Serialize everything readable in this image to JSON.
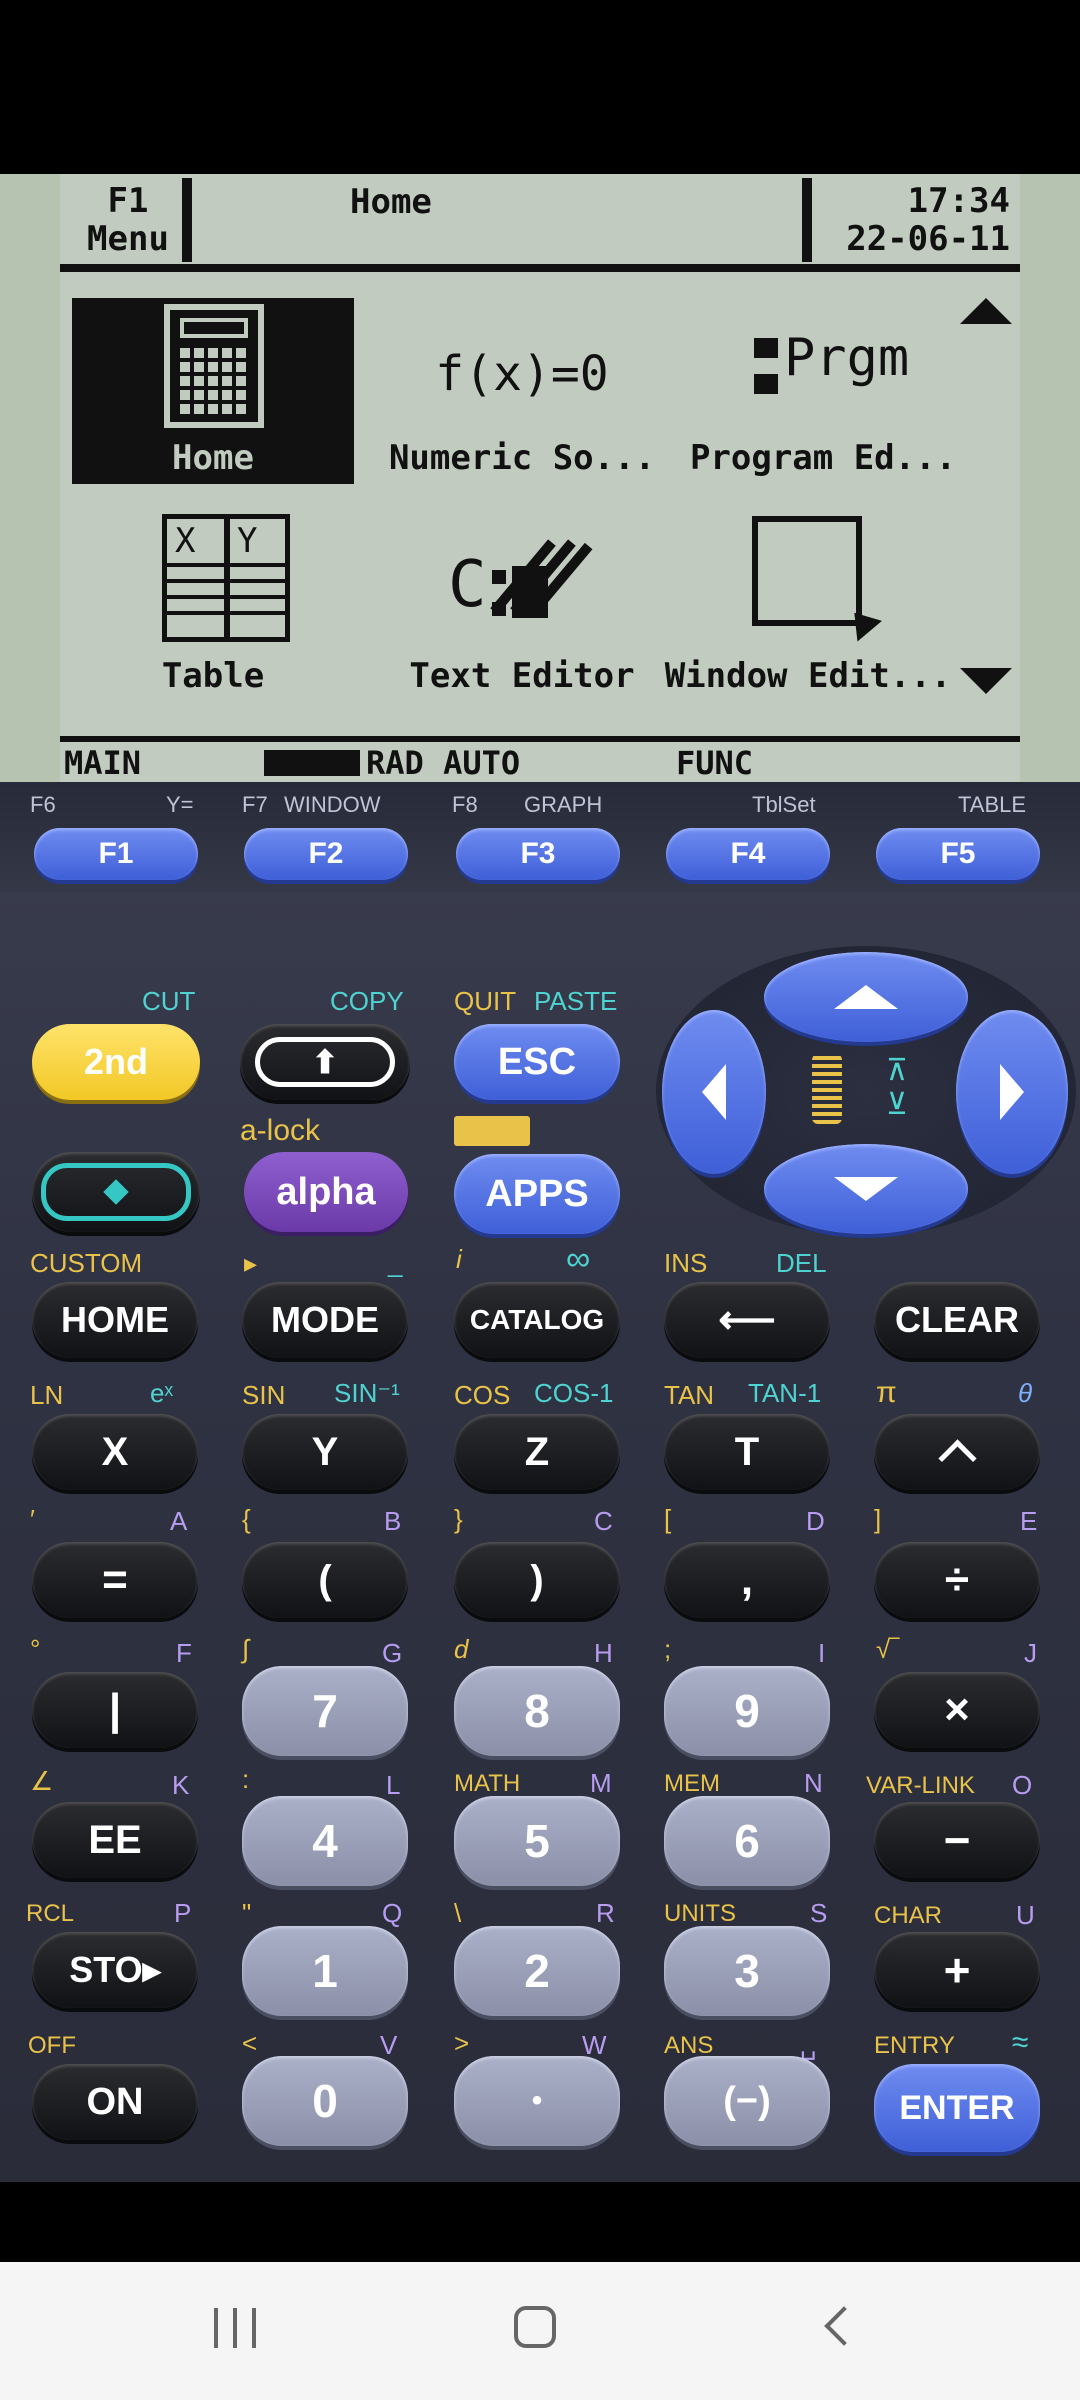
{
  "lcd": {
    "f1_label": "F1",
    "menu_label": "Menu",
    "title": "Home",
    "time": "17:34",
    "date": "22-06-11",
    "tiles": [
      {
        "label": "Home",
        "icon_text": ""
      },
      {
        "label": "Numeric So...",
        "icon_text": "f(x)=0"
      },
      {
        "label": "Program Ed...",
        "icon_text": "Prgm"
      },
      {
        "label": "Table",
        "icon_text": ""
      },
      {
        "label": "Text Editor",
        "icon_text": ""
      },
      {
        "label": "Window Edit...",
        "icon_text": ""
      }
    ],
    "status": {
      "mode": "MAIN",
      "settings": "RAD AUTO",
      "graph": "FUNC"
    }
  },
  "fkeys": [
    {
      "label": "F1",
      "alt_left": "F6",
      "alt_right": "Y="
    },
    {
      "label": "F2",
      "alt_left": "F7",
      "alt_right": "WINDOW"
    },
    {
      "label": "F3",
      "alt_left": "F8",
      "alt_right": "GRAPH"
    },
    {
      "label": "F4",
      "alt_left": "",
      "alt_right": "TblSet"
    },
    {
      "label": "F5",
      "alt_left": "",
      "alt_right": "TABLE"
    }
  ],
  "keys": {
    "second": "2nd",
    "esc": "ESC",
    "alpha": "alpha",
    "apps": "APPS",
    "home": "HOME",
    "mode": "MODE",
    "catalog": "CATALOG",
    "clear": "CLEAR",
    "x": "X",
    "y": "Y",
    "z": "Z",
    "t": "T",
    "eq": "=",
    "lparen": "(",
    "rparen": ")",
    "comma": ",",
    "div": "÷",
    "bar": "|",
    "n7": "7",
    "n8": "8",
    "n9": "9",
    "mul": "×",
    "ee": "EE",
    "n4": "4",
    "n5": "5",
    "n6": "6",
    "minus": "−",
    "sto": "STO▸",
    "n1": "1",
    "n2": "2",
    "n3": "3",
    "plus": "+",
    "on": "ON",
    "n0": "0",
    "dot": "•",
    "neg": "(−)",
    "enter": "ENTER"
  },
  "secondary": {
    "cut": "CUT",
    "copy": "COPY",
    "quit": "QUIT",
    "paste": "PASTE",
    "alock": "a-lock",
    "custom": "CUSTOM",
    "ins": "INS",
    "del": "DEL",
    "ln": "LN",
    "ex": "eˣ",
    "sin": "SIN",
    "sininv": "SIN⁻¹",
    "cos": "COS",
    "cosinv": "COS-1",
    "tan": "TAN",
    "taninv": "TAN-1",
    "pi": "π",
    "theta": "θ",
    "A": "A",
    "B": "B",
    "C": "C",
    "D": "D",
    "E": "E",
    "F": "F",
    "G": "G",
    "H": "H",
    "I": "I",
    "J": "J",
    "K": "K",
    "L": "L",
    "M": "M",
    "N": "N",
    "O": "O",
    "P": "P",
    "Q": "Q",
    "R": "R",
    "S": "S",
    "U": "U",
    "V": "V",
    "W": "W",
    "lbrace": "{",
    "rbrace": "}",
    "lbrack": "[",
    "rbrack": "]",
    "deg": "°",
    "integral": "∫",
    "d": "d",
    "semicolon": ";",
    "sqrt": "√‾",
    "angle": "∠",
    "colon": ":",
    "math": "MATH",
    "mem": "MEM",
    "varlink": "VAR-LINK",
    "rcl": "RCL",
    "quote": "\"",
    "backslash": "\\",
    "units": "UNITS",
    "char": "CHAR",
    "off": "OFF",
    "lt": "<",
    "gt": ">",
    "ans": "ANS",
    "space": "␣",
    "entry": "ENTRY",
    "approx": "≈",
    "i": "i",
    "inf": "∞",
    "prime": "′",
    "underscore": "_",
    "triangle": "▸"
  }
}
